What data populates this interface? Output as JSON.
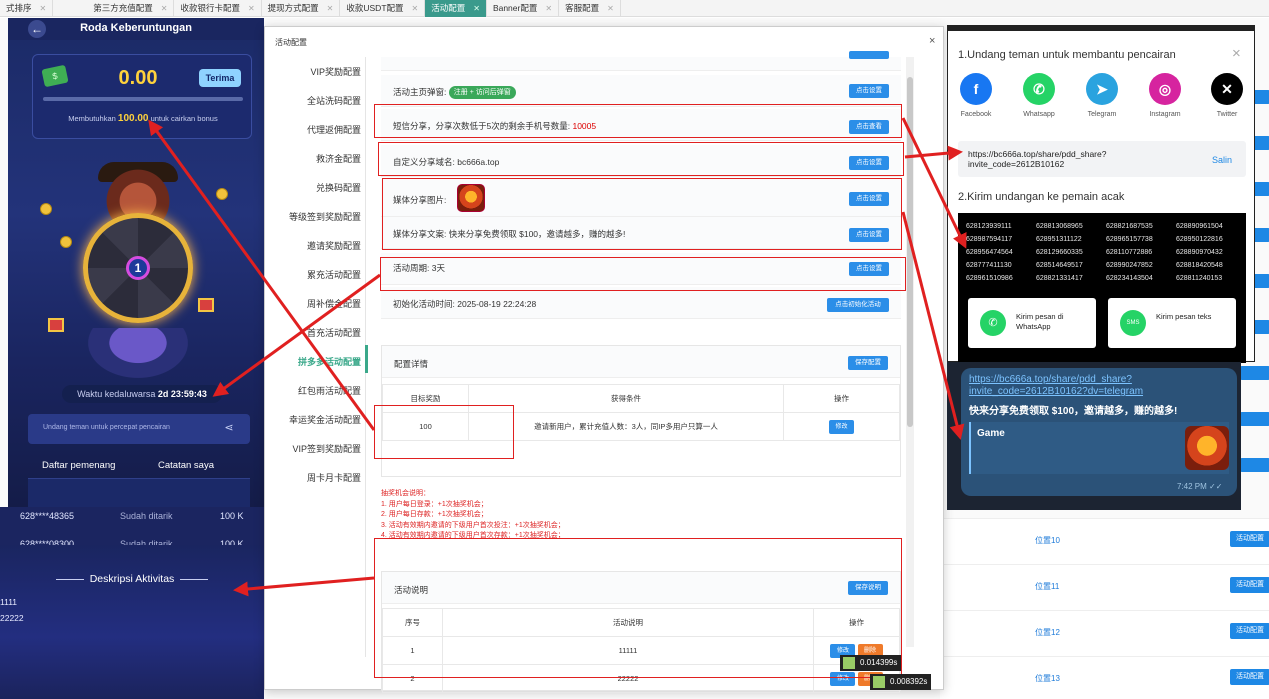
{
  "tabs": [
    {
      "label": "式排序",
      "active": false
    },
    {
      "label": "第三方充值配置",
      "active": false
    },
    {
      "label": "收款银行卡配置",
      "active": false
    },
    {
      "label": "提现方式配置",
      "active": false
    },
    {
      "label": "收款USDT配置",
      "active": false
    },
    {
      "label": "活动配置",
      "active": true
    },
    {
      "label": "Banner配置",
      "active": false
    },
    {
      "label": "客服配置",
      "active": false
    }
  ],
  "background": {
    "rows": [
      {
        "pos": "位置10",
        "btn": "活动配置"
      },
      {
        "pos": "位置11",
        "btn": "活动配置"
      },
      {
        "pos": "位置12",
        "btn": "活动配置"
      },
      {
        "pos": "位置13",
        "btn": "活动配置"
      }
    ]
  },
  "phone": {
    "title": "Roda Keberuntungan",
    "back_icon": "←",
    "money_icon": "$",
    "balance": "0.00",
    "receive_button": "Terima",
    "need_prefix": "Membutuhkan",
    "need_amount": "100.00",
    "need_suffix": "untuk cairkan bonus",
    "wheel_center": "1",
    "countdown_label": "Waktu kedaluwarsa",
    "countdown_value": "2d 23:59:43",
    "invite_text": "Undang teman untuk percepat pencairan",
    "share_icon": "⋖",
    "tab_winners": "Daftar pemenang",
    "tab_mine": "Catatan saya",
    "list": [
      {
        "masked": "628****48365",
        "status": "Sudah ditarik",
        "amount": "100 K"
      },
      {
        "masked": "628****08300",
        "status": "Sudah ditarik",
        "amount": "100 K"
      }
    ],
    "desc_title": "Deskripsi Aktivitas",
    "desc_lines": [
      "1111",
      "22222"
    ]
  },
  "modal": {
    "title": "活动配置",
    "close_icon": "×",
    "nav": [
      {
        "label": "VIP奖励配置",
        "active": false
      },
      {
        "label": "全站洗码配置",
        "active": false
      },
      {
        "label": "代理返佣配置",
        "active": false
      },
      {
        "label": "救济金配置",
        "active": false
      },
      {
        "label": "兑换码配置",
        "active": false
      },
      {
        "label": "等级签到奖励配置",
        "active": false
      },
      {
        "label": "邀请奖励配置",
        "active": false
      },
      {
        "label": "累充活动配置",
        "active": false
      },
      {
        "label": "周补偿金配置",
        "active": false
      },
      {
        "label": "首充活动配置",
        "active": false
      },
      {
        "label": "拼多多活动配置",
        "active": true
      },
      {
        "label": "红包雨活动配置",
        "active": false
      },
      {
        "label": "幸运奖金活动配置",
        "active": false
      },
      {
        "label": "VIP签到奖励配置",
        "active": false
      },
      {
        "label": "周卡月卡配置",
        "active": false
      }
    ],
    "settings": {
      "popup_label": "活动主页弹窗:",
      "popup_value": "注册 + 访问后弹窗",
      "sms_label": "短信分享，分享次数低于5次的剩余手机号数量:",
      "sms_value": "10005",
      "domain_label": "自定义分享域名:",
      "domain_value": "bc666a.top",
      "media_img_label": "媒体分享图片:",
      "media_text_label": "媒体分享文案:",
      "media_text_value": "快来分享免费领取 $100，邀请越多，赚的越多!",
      "period_label": "活动周期:",
      "period_value": "3天",
      "init_label": "初始化活动时间:",
      "init_value": "2025-08-19 22:24:28",
      "btn_set": "点击设置",
      "btn_view": "点击查看",
      "btn_init": "点击初始化活动"
    },
    "config": {
      "title": "配置详情",
      "save": "保存配置",
      "headers": [
        "目标奖励",
        "获得条件",
        "操作"
      ],
      "rows": [
        {
          "reward": "100",
          "condition": "邀请新用户，累计充值人数：3人，同IP多用户只算一人",
          "action": "修改"
        }
      ]
    },
    "rules": [
      "抽奖机会说明：",
      "1. 用户每日登录：+1次抽奖机会；",
      "2. 用户每日存款：+1次抽奖机会；",
      "3. 活动有效期内邀请的下级用户首次投注：+1次抽奖机会；",
      "4. 活动有效期内邀请的下级用户首次存款：+1次抽奖机会；"
    ],
    "description": {
      "title": "活动说明",
      "save": "保存说明",
      "headers": [
        "序号",
        "活动说明",
        "操作"
      ],
      "rows": [
        {
          "no": "1",
          "text": "11111",
          "edit": "修改",
          "del": "删除"
        },
        {
          "no": "2",
          "text": "22222",
          "edit": "修改",
          "del": "删除"
        }
      ]
    }
  },
  "share": {
    "title": "1.Undang teman untuk membantu pencairan",
    "close_icon": "×",
    "socials": [
      {
        "name": "Facebook",
        "glyph": "f",
        "color": "#1877f2"
      },
      {
        "name": "Whatsapp",
        "glyph": "✆",
        "color": "#25d366"
      },
      {
        "name": "Telegram",
        "glyph": "➤",
        "color": "#2aa3df"
      },
      {
        "name": "Instagram",
        "glyph": "◎",
        "color": "#d6249f"
      },
      {
        "name": "Twitter",
        "glyph": "✕",
        "color": "#000000"
      }
    ],
    "link": "https://bc666a.top/share/pdd_share?invite_code=2612B10162",
    "copy": "Salin",
    "title2": "2.Kirim undangan ke pemain acak",
    "numbers": [
      [
        "628123939111",
        "628813068965",
        "628821687535",
        "628890961504"
      ],
      [
        "628987594117",
        "628951311122",
        "628965157738",
        "628950122816"
      ],
      [
        "628956474564",
        "628129660335",
        "628110772886",
        "628890970432"
      ],
      [
        "628777411130",
        "628514649517",
        "628990247852",
        "628818420548"
      ],
      [
        "628961510986",
        "628821331417",
        "628234143504",
        "628811240153"
      ]
    ],
    "send_whatsapp": "Kirim pesan di WhatsApp",
    "send_sms": "Kirim pesan teks",
    "whatsapp_glyph": "✆",
    "sms_glyph": "SMS"
  },
  "telegram": {
    "link": "https://bc666a.top/share/pdd_share?invite_code=2612B10162?dv=telegram",
    "message": "快来分享免费领取 $100，邀请越多，赚的越多!",
    "card_title": "Game",
    "time": "7:42 PM ✓✓"
  },
  "timings": [
    "0.014399s",
    "0.008392s"
  ]
}
